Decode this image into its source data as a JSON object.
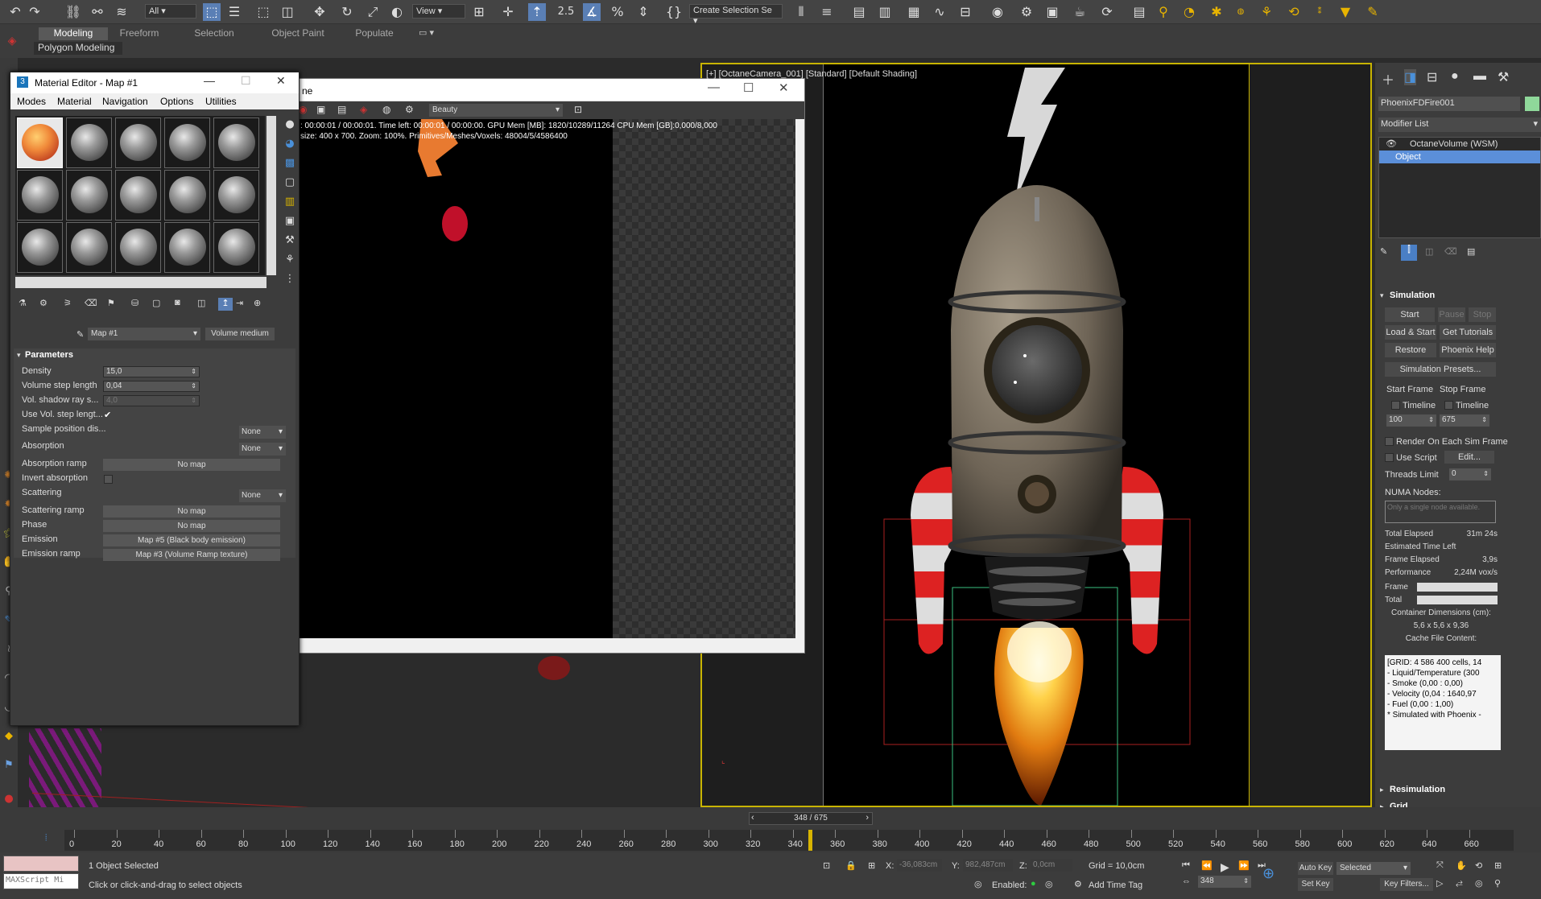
{
  "toolbar": {
    "filter_dropdown": "All",
    "view_dropdown": "View",
    "snap_label": "2.5",
    "create_selection_set": "Create Selection Se",
    "undo_icon": "undo-icon",
    "redo_icon": "redo-icon"
  },
  "ribbon": {
    "tabs": [
      "Modeling",
      "Freeform",
      "Selection",
      "Object Paint",
      "Populate"
    ],
    "active_tab": "Modeling",
    "sub_label": "Polygon Modeling"
  },
  "material_editor": {
    "title": "Material Editor - Map #1",
    "menu": [
      "Modes",
      "Material",
      "Navigation",
      "Options",
      "Utilities"
    ],
    "map_name": "Map #1",
    "map_type": "Volume medium",
    "section_title": "Parameters",
    "params": {
      "density_label": "Density",
      "density_value": "15,0",
      "volume_step_label": "Volume step length",
      "volume_step_value": "0,04",
      "vol_shadow_label": "Vol. shadow ray s...",
      "vol_shadow_value": "4,0",
      "use_vol_step_label": "Use Vol. step lengt...",
      "sample_pos_label": "Sample position dis...",
      "sample_pos_value": "None",
      "absorption_label": "Absorption",
      "absorption_value": "None",
      "absorption_ramp_label": "Absorption ramp",
      "absorption_ramp_value": "No map",
      "invert_absorption_label": "Invert absorption",
      "scattering_label": "Scattering",
      "scattering_value": "None",
      "scattering_ramp_label": "Scattering ramp",
      "scattering_ramp_value": "No map",
      "phase_label": "Phase",
      "phase_value": "No map",
      "emission_label": "Emission",
      "emission_value": "Map #5 (Black body emission)",
      "emission_ramp_label": "Emission ramp",
      "emission_ramp_value": "Map #3 (Volume Ramp texture)"
    }
  },
  "render_window": {
    "title": "ne",
    "pass_dropdown": "Beauty",
    "status_line1": ": 00:00:01 / 00:00:01.  Time left: 00:00:01 / 00:00:00.  GPU Mem [MB]: 1820/10289/11264  CPU Mem [GB]:0,000/8,000",
    "status_line2": "size: 400 x 700.  Zoom: 100%.  Primitives/Meshes/Voxels: 48004/5/4586400"
  },
  "viewport": {
    "label": "[+] [OctaneCamera_001] [Standard] [Default Shading]"
  },
  "right_panel": {
    "object_name": "PhoenixFDFire001",
    "modifier_list": "Modifier List",
    "stack_items": [
      "OctaneVolume (WSM)",
      "Object"
    ],
    "simulation_title": "Simulation",
    "buttons": {
      "start": "Start",
      "pause": "Pause",
      "stop": "Stop",
      "load_start": "Load & Start",
      "get_tutorials": "Get Tutorials",
      "restore": "Restore",
      "phoenix_help": "Phoenix Help",
      "presets": "Simulation Presets...",
      "edit": "Edit..."
    },
    "start_frame_label": "Start Frame",
    "stop_frame_label": "Stop Frame",
    "timeline_label": "Timeline",
    "start_frame_value": "100",
    "stop_frame_value": "675",
    "render_each_frame": "Render On Each Sim Frame",
    "use_script": "Use Script",
    "threads_limit_label": "Threads Limit",
    "threads_limit_value": "0",
    "numa_label": "NUMA Nodes:",
    "numa_placeholder": "Only a single node available.",
    "stats": [
      {
        "label": "Total Elapsed",
        "value": "31m 24s"
      },
      {
        "label": "Estimated Time Left",
        "value": ""
      },
      {
        "label": "Frame Elapsed",
        "value": "3,9s"
      },
      {
        "label": "Performance",
        "value": "2,24M vox/s"
      }
    ],
    "frame_label": "Frame",
    "total_label": "Total",
    "container_dims_label": "Container Dimensions (cm):",
    "container_dims_value": "5,6 x 5,6 x 9,36",
    "cache_content_label": "Cache File Content:",
    "cache_lines": [
      "[GRID: 4 586 400 cells, 14",
      "- Liquid/Temperature (300",
      "- Smoke (0,00 : 0,00)",
      "- Velocity (0,04 : 1640,97",
      "- Fuel (0,00 : 1,00)",
      "* Simulated with Phoenix -"
    ],
    "resimulation_title": "Resimulation",
    "grid_title": "Grid"
  },
  "timeline": {
    "frame_display": "348 / 675",
    "current_frame": 348,
    "ticks": [
      "0",
      "20",
      "40",
      "60",
      "80",
      "100",
      "120",
      "140",
      "160",
      "180",
      "200",
      "220",
      "240",
      "260",
      "280",
      "300",
      "320",
      "340",
      "360",
      "380",
      "400",
      "420",
      "440",
      "460",
      "480",
      "500",
      "520",
      "540",
      "560",
      "580",
      "600",
      "620",
      "640",
      "660"
    ]
  },
  "status_bar": {
    "script_placeholder": "MAXScript Mi",
    "selection_info": "1 Object Selected",
    "prompt": "Click or click-and-drag to select objects",
    "x_label": "X:",
    "x_value": "-36,083cm",
    "y_label": "Y:",
    "y_value": "982,487cm",
    "z_label": "Z:",
    "z_value": "0,0cm",
    "grid": "Grid = 10,0cm",
    "enabled_label": "Enabled:",
    "add_time_tag": "Add Time Tag",
    "auto_key": "Auto Key",
    "set_key": "Set Key",
    "selected_dropdown": "Selected",
    "key_filters": "Key Filters...",
    "frame_spinner": "348"
  }
}
